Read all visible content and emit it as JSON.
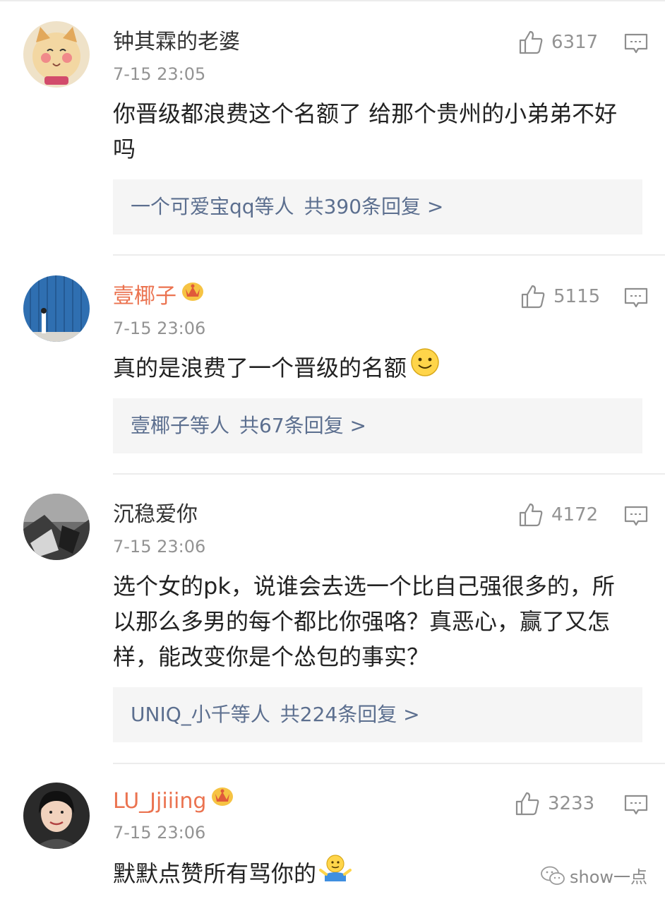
{
  "comments": [
    {
      "user": "钟其霖的老婆",
      "vip": false,
      "time": "7-15 23:05",
      "likes": "6317",
      "text": "你晋级都浪费这个名额了 给那个贵州的小弟弟不好吗",
      "reply_who": "一个可爱宝qq等人",
      "reply_count": "共390条回复 >"
    },
    {
      "user": "壹椰子",
      "vip": true,
      "time": "7-15 23:06",
      "likes": "5115",
      "text": "真的是浪费了一个晋级的名额",
      "emoji": "smile-emoji",
      "reply_who": "壹椰子等人",
      "reply_count": "共67条回复 >"
    },
    {
      "user": "沉稳爱你",
      "vip": false,
      "time": "7-15 23:06",
      "likes": "4172",
      "text": "选个女的pk，说谁会去选一个比自己强很多的，所以那么多男的每个都比你强咯？真恶心，赢了又怎样，能改变你是个怂包的事实？",
      "reply_who": "UNIQ_小千等人",
      "reply_count": "共224条回复 >"
    },
    {
      "user": "LU_Jjiiing",
      "vip": true,
      "time": "7-15 23:06",
      "likes": "3233",
      "text": "默默点赞所有骂你的",
      "emoji": "shrug-emoji"
    }
  ],
  "watermark": "show一点",
  "colors": {
    "vip_name": "#eb7350",
    "reply_link": "#5c6f8f",
    "meta": "#939393"
  }
}
